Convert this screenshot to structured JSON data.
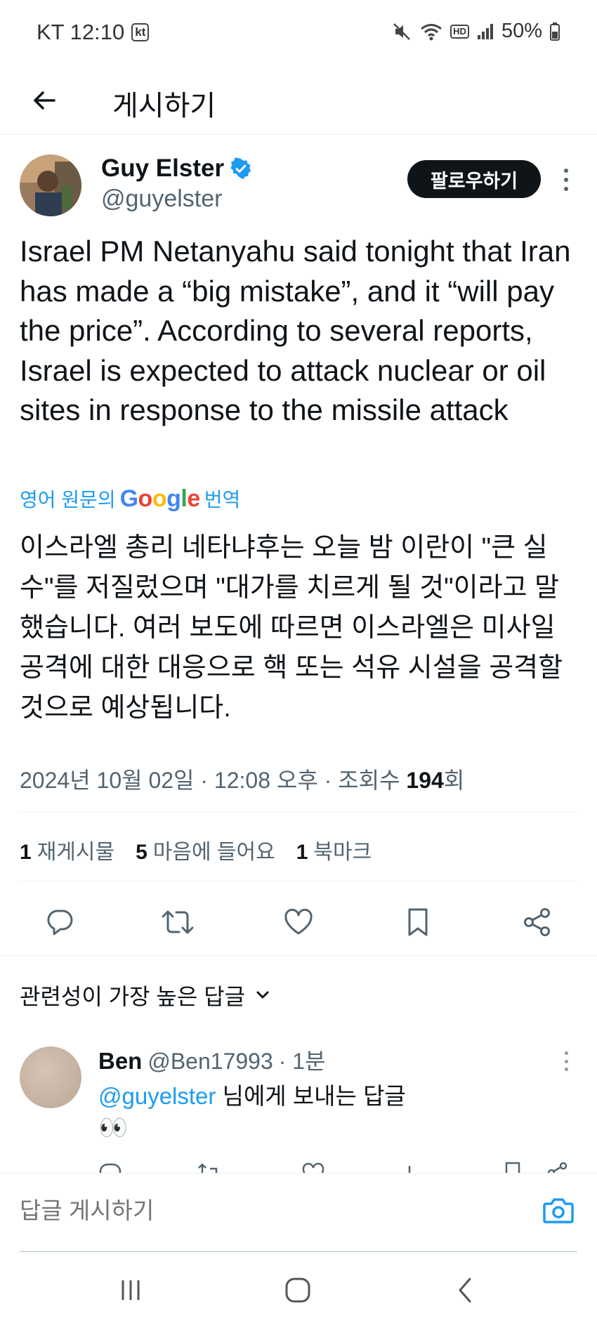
{
  "status_bar": {
    "carrier_time": "KT 12:10",
    "carrier_badge": "kt",
    "hd_badge": "HD",
    "battery": "50%"
  },
  "header": {
    "title": "게시하기"
  },
  "tweet": {
    "author_name": "Guy Elster",
    "author_handle": "@guyelster",
    "follow_label": "팔로우하기",
    "text": "Israel PM Netanyahu said tonight that Iran has made a “big mistake”, and it “will pay the price”. According to several reports, Israel is expected to attack nuclear or oil sites in response to the missile attack",
    "translate_prefix": "영어 원문의",
    "translate_brand": "Google",
    "translate_suffix": "번역",
    "translated_text": "이스라엘 총리 네타냐후는 오늘 밤 이란이 \"큰 실수\"를 저질렀으며 \"대가를 치르게 될 것\"이라고 말했습니다. 여러 보도에 따르면 이스라엘은 미사일 공격에 대한 대응으로 핵 또는 석유 시설을 공격할 것으로 예상됩니다.",
    "date_time": "2024년 10월 02일 · 12:08 오후 · 조회수",
    "view_count": "194",
    "view_unit": "회",
    "stats": {
      "reposts_count": "1",
      "reposts_label": "재게시물",
      "likes_count": "5",
      "likes_label": "마음에 들어요",
      "bookmarks_count": "1",
      "bookmarks_label": "북마크"
    }
  },
  "replies": {
    "sort_label": "관련성이 가장 높은 답글",
    "items": [
      {
        "name": "Ben",
        "handle": "@Ben17993",
        "time": "· 1분",
        "reply_to_mention": "@guyelster",
        "reply_to_suffix": "님에게 보내는 답글",
        "body": "👀"
      }
    ]
  },
  "compose": {
    "placeholder": "답글 게시하기"
  },
  "colors": {
    "accent": "#1d9bf0",
    "text": "#0f1419",
    "secondary": "#536471"
  }
}
